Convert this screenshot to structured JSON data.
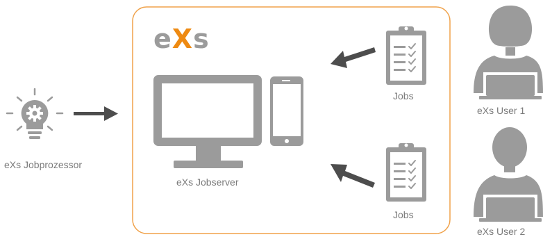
{
  "logo": {
    "prefix": "e",
    "accent": "X",
    "suffix": "s"
  },
  "labels": {
    "jobprozessor": "eXs Jobprozessor",
    "jobserver": "eXs Jobserver",
    "jobs_top": "Jobs",
    "jobs_bottom": "Jobs",
    "user1": "eXs User 1",
    "user2": "eXs User 2"
  },
  "colors": {
    "accent": "#ee8a12",
    "icon_gray": "#9b9b9b",
    "arrow_dark": "#4d4d4d",
    "text": "#7b7b7b",
    "box_border": "#f0a24a"
  },
  "icons": [
    "lightbulb-gear-icon",
    "monitor-icon",
    "smartphone-icon",
    "clipboard-checklist-icon",
    "user-female-laptop-icon",
    "user-male-laptop-icon"
  ]
}
